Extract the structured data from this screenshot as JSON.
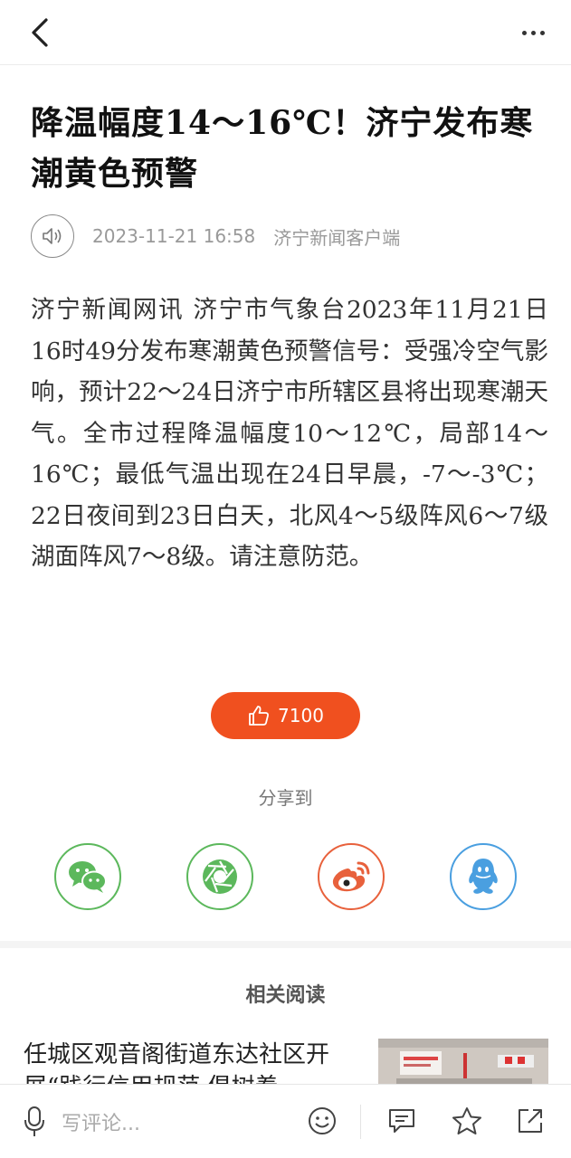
{
  "article": {
    "title": "降温幅度14～16℃！济宁发布寒潮黄色预警",
    "date": "2023-11-21 16:58",
    "source": "济宁新闻客户端",
    "body": "济宁新闻网讯 济宁市气象台2023年11月21日16时49分发布寒潮黄色预警信号：受强冷空气影响，预计22～24日济宁市所辖区县将出现寒潮天气。全市过程降温幅度10～12℃，局部14～16℃；最低气温出现在24日早晨，-7～-3℃；22日夜间到23日白天，北风4～5级阵风6～7级湖面阵风7～8级。请注意防范。"
  },
  "like": {
    "count": "7100"
  },
  "share": {
    "label": "分享到",
    "targets": [
      {
        "icon": "wechat-icon",
        "color": "#5cb85c"
      },
      {
        "icon": "moments-icon",
        "color": "#5cb85c"
      },
      {
        "icon": "weibo-icon",
        "color": "#e8613c"
      },
      {
        "icon": "qq-icon",
        "color": "#4a9fe0"
      }
    ]
  },
  "related": {
    "title": "相关阅读",
    "items": [
      {
        "title": "任城区观音阁街道东达社区开展“践行信用规范 倡树着"
      }
    ]
  },
  "bottombar": {
    "comment_placeholder": "写评论..."
  },
  "colors": {
    "accent": "#f0501f"
  }
}
